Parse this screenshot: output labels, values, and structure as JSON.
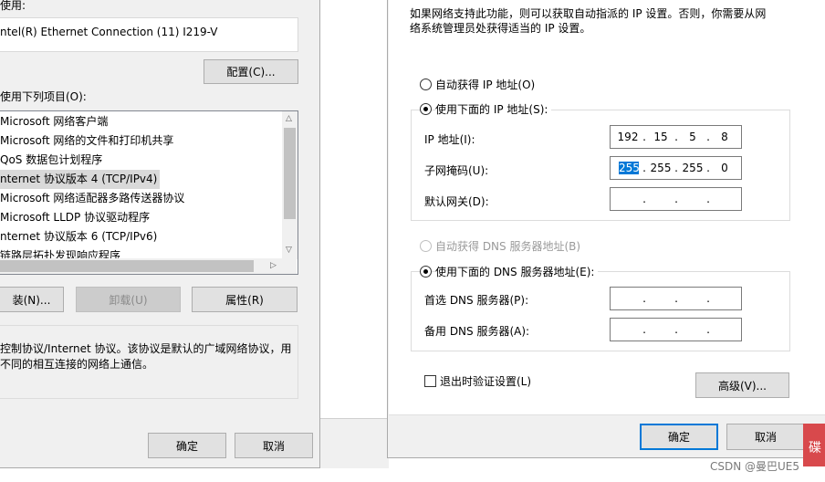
{
  "left_dialog": {
    "connect_using_label": "使用:",
    "adapter_name": "ntel(R) Ethernet Connection (11) I219-V",
    "configure_button": "配置(C)...",
    "items_label": "使用下列项目(O):",
    "items": [
      {
        "label": "Microsoft 网络客户端",
        "selected": false
      },
      {
        "label": "Microsoft 网络的文件和打印机共享",
        "selected": false
      },
      {
        "label": "QoS 数据包计划程序",
        "selected": false
      },
      {
        "label": "nternet 协议版本 4 (TCP/IPv4)",
        "selected": true
      },
      {
        "label": "Microsoft 网络适配器多路传送器协议",
        "selected": false
      },
      {
        "label": "Microsoft LLDP 协议驱动程序",
        "selected": false
      },
      {
        "label": "nternet 协议版本 6 (TCP/IPv6)",
        "selected": false
      },
      {
        "label": "链路层拓扑发现响应程序",
        "selected": false
      }
    ],
    "install_button": "装(N)...",
    "uninstall_button": "卸载(U)",
    "properties_button": "属性(R)",
    "description_line1": "控制协议/Internet 协议。该协议是默认的广域网络协议，用",
    "description_line2": "不同的相互连接的网络上通信。",
    "ok_button": "确定",
    "cancel_button": "取消"
  },
  "right_dialog": {
    "intro_line1": "如果网络支持此功能，则可以获取自动指派的 IP 设置。否则，你需要从网",
    "intro_line2": "络系统管理员处获得适当的 IP 设置。",
    "auto_ip_label": "自动获得 IP 地址(O)",
    "manual_ip_label": "使用下面的 IP 地址(S):",
    "ip_selection": "manual",
    "ip_address_label": "IP 地址(I):",
    "ip_address": [
      "192",
      "15",
      "5",
      "8"
    ],
    "subnet_label": "子网掩码(U):",
    "subnet_mask": [
      "255",
      "255",
      "255",
      "0"
    ],
    "gateway_label": "默认网关(D):",
    "gateway": [
      "",
      "",
      "",
      ""
    ],
    "auto_dns_label": "自动获得 DNS 服务器地址(B)",
    "manual_dns_label": "使用下面的 DNS 服务器地址(E):",
    "dns_selection": "manual",
    "preferred_dns_label": "首选 DNS 服务器(P):",
    "preferred_dns": [
      "",
      "",
      "",
      ""
    ],
    "alternate_dns_label": "备用 DNS 服务器(A):",
    "alternate_dns": [
      "",
      "",
      "",
      ""
    ],
    "validate_label": "退出时验证设置(L)",
    "validate_checked": false,
    "advanced_button": "高级(V)...",
    "ok_button": "确定",
    "cancel_button": "取消"
  },
  "overlay": {
    "red_block_text": "碟",
    "watermark": "CSDN @曼巴UE5"
  },
  "colors": {
    "dialog_bg": "#f0f0f0",
    "accent": "#0078d7",
    "selection": "#d9d9d9",
    "red_block": "#d8494c"
  }
}
